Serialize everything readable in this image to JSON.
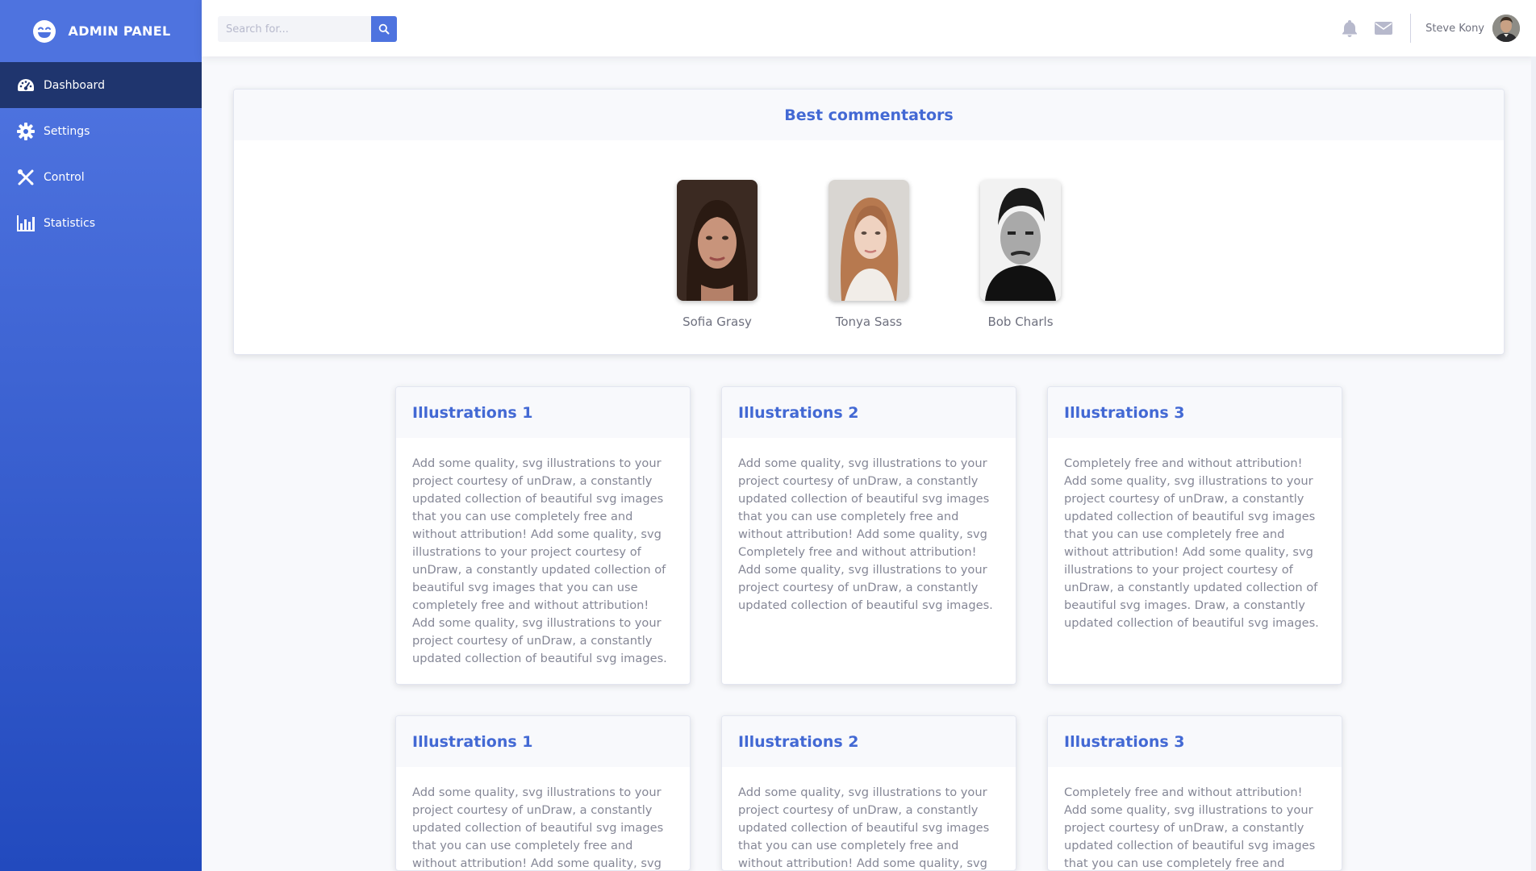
{
  "brand": {
    "name": "ADMIN PANEL"
  },
  "sidebar": {
    "items": [
      {
        "label": "Dashboard",
        "icon": "dashboard-gauge-icon"
      },
      {
        "label": "Settings",
        "icon": "gear-icon"
      },
      {
        "label": "Control",
        "icon": "tools-icon"
      },
      {
        "label": "Statistics",
        "icon": "bar-chart-icon"
      }
    ]
  },
  "topbar": {
    "search": {
      "placeholder": "Search for..."
    },
    "user": {
      "name": "Steve Kony"
    }
  },
  "commentators": {
    "title": "Best commentators",
    "people": [
      {
        "name": "Sofia Grasy"
      },
      {
        "name": "Tonya Sass"
      },
      {
        "name": "Bob Charls"
      }
    ]
  },
  "cards": [
    {
      "title": "Illustrations 1",
      "text": "Add some quality, svg illustrations to your project courtesy of unDraw, a constantly updated collection of beautiful svg images that you can use completely free and without attribution! Add some quality, svg illustrations to your project courtesy of unDraw, a constantly updated collection of beautiful svg images that you can use completely free and without attribution! Add some quality, svg illustrations to your project courtesy of unDraw, a constantly updated collection of beautiful svg images."
    },
    {
      "title": "Illustrations 2",
      "text": "Add some quality, svg illustrations to your project courtesy of unDraw, a constantly updated collection of beautiful svg images that you can use completely free and without attribution! Add some quality, svg Completely free and without attribution! Add some quality, svg illustrations to your project courtesy of unDraw, a constantly updated collection of beautiful svg images."
    },
    {
      "title": "Illustrations 3",
      "text": "Completely free and without attribution! Add some quality, svg illustrations to your project courtesy of unDraw, a constantly updated collection of beautiful svg images that you can use completely free and without attribution! Add some quality, svg illustrations to your project courtesy of unDraw, a constantly updated collection of beautiful svg images. Draw, a constantly updated collection of beautiful svg images."
    },
    {
      "title": "Illustrations 1",
      "text": "Add some quality, svg illustrations to your project courtesy of unDraw, a constantly updated collection of beautiful svg images that you can use completely free and without attribution! Add some quality, svg"
    },
    {
      "title": "Illustrations 2",
      "text": "Add some quality, svg illustrations to your project courtesy of unDraw, a constantly updated collection of beautiful svg images that you can use completely free and without attribution! Add some quality, svg"
    },
    {
      "title": "Illustrations 3",
      "text": "Completely free and without attribution! Add some quality, svg illustrations to your project courtesy of unDraw, a constantly updated collection of beautiful svg images that you can use completely free and without"
    }
  ],
  "colors": {
    "primary": "#4e73df",
    "sidebar_active": "#1f356e",
    "title": "#4369d4"
  }
}
